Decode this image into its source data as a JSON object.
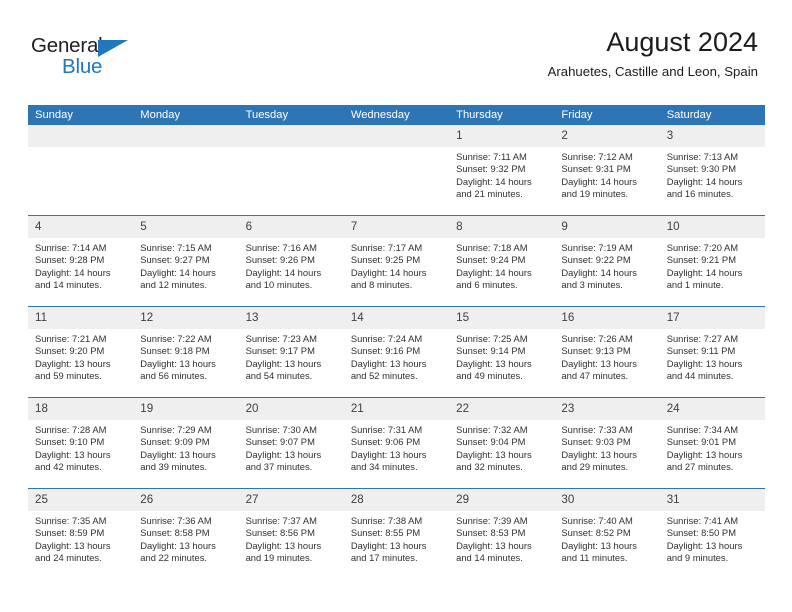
{
  "brand": {
    "name_part1": "General",
    "name_part2": "Blue",
    "triangle_icon": "triangle-icon",
    "primary_color": "#1f77bc"
  },
  "header": {
    "title": "August 2024",
    "subtitle": "Arahuetes, Castille and Leon, Spain"
  },
  "theme": {
    "header_blue": "#2e75b6",
    "daynum_band": "#efefef",
    "text": "#313131"
  },
  "weekday_headers": [
    "Sunday",
    "Monday",
    "Tuesday",
    "Wednesday",
    "Thursday",
    "Friday",
    "Saturday"
  ],
  "weeks": [
    [
      {
        "day": "",
        "blank": true
      },
      {
        "day": "",
        "blank": true
      },
      {
        "day": "",
        "blank": true
      },
      {
        "day": "",
        "blank": true
      },
      {
        "day": "1",
        "sunrise": "Sunrise: 7:11 AM",
        "sunset": "Sunset: 9:32 PM",
        "daylight": "Daylight: 14 hours and 21 minutes."
      },
      {
        "day": "2",
        "sunrise": "Sunrise: 7:12 AM",
        "sunset": "Sunset: 9:31 PM",
        "daylight": "Daylight: 14 hours and 19 minutes."
      },
      {
        "day": "3",
        "sunrise": "Sunrise: 7:13 AM",
        "sunset": "Sunset: 9:30 PM",
        "daylight": "Daylight: 14 hours and 16 minutes."
      }
    ],
    [
      {
        "day": "4",
        "sunrise": "Sunrise: 7:14 AM",
        "sunset": "Sunset: 9:28 PM",
        "daylight": "Daylight: 14 hours and 14 minutes."
      },
      {
        "day": "5",
        "sunrise": "Sunrise: 7:15 AM",
        "sunset": "Sunset: 9:27 PM",
        "daylight": "Daylight: 14 hours and 12 minutes."
      },
      {
        "day": "6",
        "sunrise": "Sunrise: 7:16 AM",
        "sunset": "Sunset: 9:26 PM",
        "daylight": "Daylight: 14 hours and 10 minutes."
      },
      {
        "day": "7",
        "sunrise": "Sunrise: 7:17 AM",
        "sunset": "Sunset: 9:25 PM",
        "daylight": "Daylight: 14 hours and 8 minutes."
      },
      {
        "day": "8",
        "sunrise": "Sunrise: 7:18 AM",
        "sunset": "Sunset: 9:24 PM",
        "daylight": "Daylight: 14 hours and 6 minutes."
      },
      {
        "day": "9",
        "sunrise": "Sunrise: 7:19 AM",
        "sunset": "Sunset: 9:22 PM",
        "daylight": "Daylight: 14 hours and 3 minutes."
      },
      {
        "day": "10",
        "sunrise": "Sunrise: 7:20 AM",
        "sunset": "Sunset: 9:21 PM",
        "daylight": "Daylight: 14 hours and 1 minute."
      }
    ],
    [
      {
        "day": "11",
        "sunrise": "Sunrise: 7:21 AM",
        "sunset": "Sunset: 9:20 PM",
        "daylight": "Daylight: 13 hours and 59 minutes."
      },
      {
        "day": "12",
        "sunrise": "Sunrise: 7:22 AM",
        "sunset": "Sunset: 9:18 PM",
        "daylight": "Daylight: 13 hours and 56 minutes."
      },
      {
        "day": "13",
        "sunrise": "Sunrise: 7:23 AM",
        "sunset": "Sunset: 9:17 PM",
        "daylight": "Daylight: 13 hours and 54 minutes."
      },
      {
        "day": "14",
        "sunrise": "Sunrise: 7:24 AM",
        "sunset": "Sunset: 9:16 PM",
        "daylight": "Daylight: 13 hours and 52 minutes."
      },
      {
        "day": "15",
        "sunrise": "Sunrise: 7:25 AM",
        "sunset": "Sunset: 9:14 PM",
        "daylight": "Daylight: 13 hours and 49 minutes."
      },
      {
        "day": "16",
        "sunrise": "Sunrise: 7:26 AM",
        "sunset": "Sunset: 9:13 PM",
        "daylight": "Daylight: 13 hours and 47 minutes."
      },
      {
        "day": "17",
        "sunrise": "Sunrise: 7:27 AM",
        "sunset": "Sunset: 9:11 PM",
        "daylight": "Daylight: 13 hours and 44 minutes."
      }
    ],
    [
      {
        "day": "18",
        "sunrise": "Sunrise: 7:28 AM",
        "sunset": "Sunset: 9:10 PM",
        "daylight": "Daylight: 13 hours and 42 minutes."
      },
      {
        "day": "19",
        "sunrise": "Sunrise: 7:29 AM",
        "sunset": "Sunset: 9:09 PM",
        "daylight": "Daylight: 13 hours and 39 minutes."
      },
      {
        "day": "20",
        "sunrise": "Sunrise: 7:30 AM",
        "sunset": "Sunset: 9:07 PM",
        "daylight": "Daylight: 13 hours and 37 minutes."
      },
      {
        "day": "21",
        "sunrise": "Sunrise: 7:31 AM",
        "sunset": "Sunset: 9:06 PM",
        "daylight": "Daylight: 13 hours and 34 minutes."
      },
      {
        "day": "22",
        "sunrise": "Sunrise: 7:32 AM",
        "sunset": "Sunset: 9:04 PM",
        "daylight": "Daylight: 13 hours and 32 minutes."
      },
      {
        "day": "23",
        "sunrise": "Sunrise: 7:33 AM",
        "sunset": "Sunset: 9:03 PM",
        "daylight": "Daylight: 13 hours and 29 minutes."
      },
      {
        "day": "24",
        "sunrise": "Sunrise: 7:34 AM",
        "sunset": "Sunset: 9:01 PM",
        "daylight": "Daylight: 13 hours and 27 minutes."
      }
    ],
    [
      {
        "day": "25",
        "sunrise": "Sunrise: 7:35 AM",
        "sunset": "Sunset: 8:59 PM",
        "daylight": "Daylight: 13 hours and 24 minutes."
      },
      {
        "day": "26",
        "sunrise": "Sunrise: 7:36 AM",
        "sunset": "Sunset: 8:58 PM",
        "daylight": "Daylight: 13 hours and 22 minutes."
      },
      {
        "day": "27",
        "sunrise": "Sunrise: 7:37 AM",
        "sunset": "Sunset: 8:56 PM",
        "daylight": "Daylight: 13 hours and 19 minutes."
      },
      {
        "day": "28",
        "sunrise": "Sunrise: 7:38 AM",
        "sunset": "Sunset: 8:55 PM",
        "daylight": "Daylight: 13 hours and 17 minutes."
      },
      {
        "day": "29",
        "sunrise": "Sunrise: 7:39 AM",
        "sunset": "Sunset: 8:53 PM",
        "daylight": "Daylight: 13 hours and 14 minutes."
      },
      {
        "day": "30",
        "sunrise": "Sunrise: 7:40 AM",
        "sunset": "Sunset: 8:52 PM",
        "daylight": "Daylight: 13 hours and 11 minutes."
      },
      {
        "day": "31",
        "sunrise": "Sunrise: 7:41 AM",
        "sunset": "Sunset: 8:50 PM",
        "daylight": "Daylight: 13 hours and 9 minutes."
      }
    ]
  ]
}
